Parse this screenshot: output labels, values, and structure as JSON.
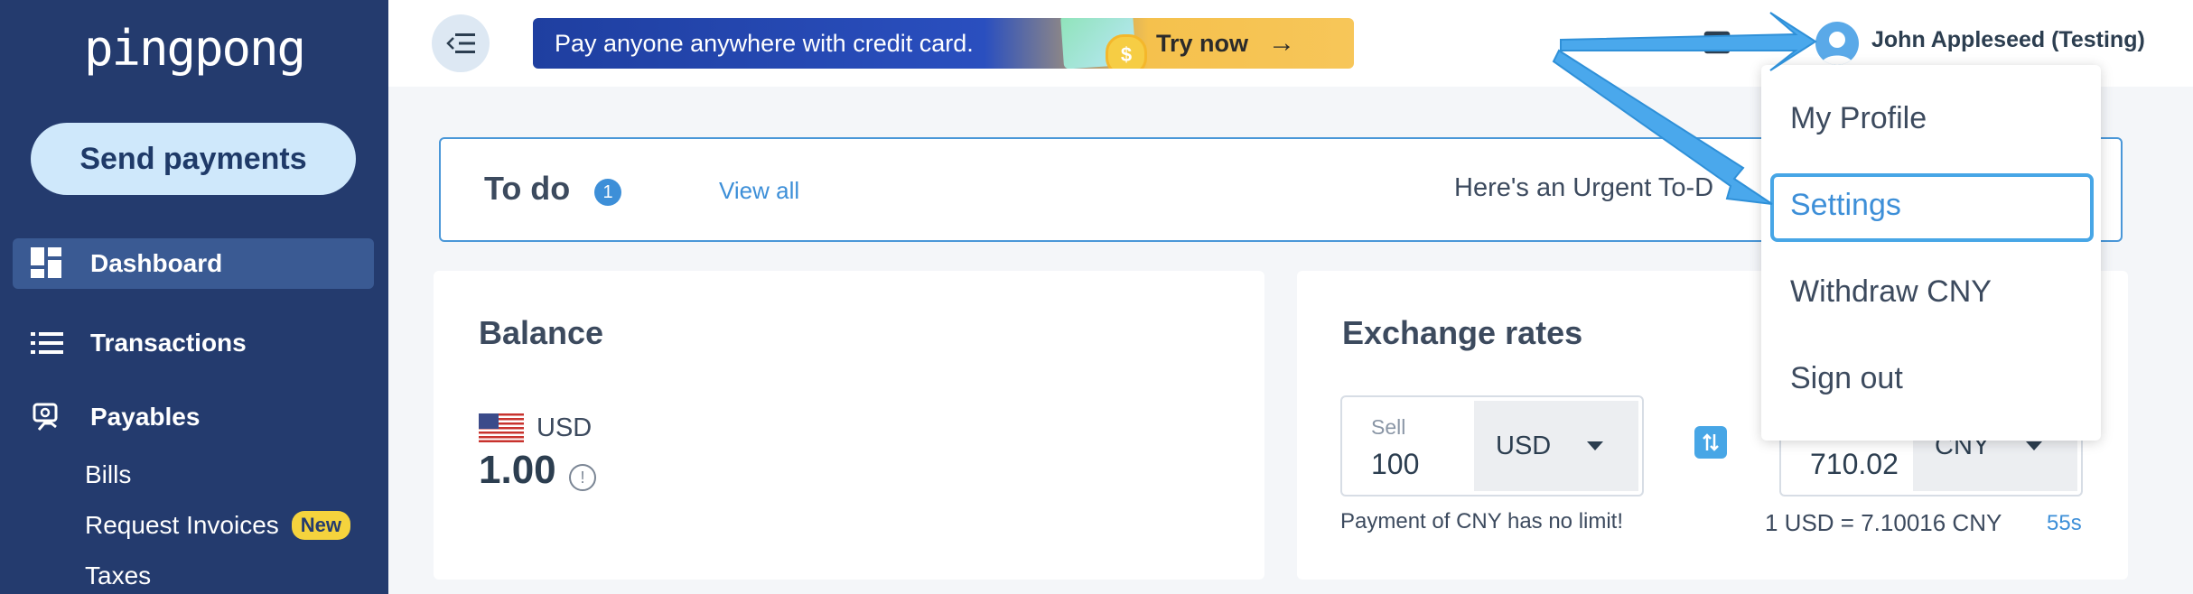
{
  "app": {
    "logo": "pingpong"
  },
  "sidebar": {
    "send_button": "Send payments",
    "items": [
      {
        "label": "Dashboard",
        "icon": "dashboard-icon",
        "active": true
      },
      {
        "label": "Transactions",
        "icon": "list-icon"
      },
      {
        "label": "Payables",
        "icon": "payables-icon"
      }
    ],
    "sub_items": [
      {
        "label": "Bills"
      },
      {
        "label": "Request Invoices",
        "badge": "New"
      },
      {
        "label": "Taxes"
      }
    ]
  },
  "topbar": {
    "promo_text": "Pay anyone anywhere with credit card.",
    "promo_cta": "Try now",
    "promo_coin": "$",
    "user_name": "John Appleseed (Testing)"
  },
  "todo": {
    "title": "To do",
    "count": "1",
    "view_all": "View all",
    "urgent_text": "Here's an Urgent To-D"
  },
  "balance": {
    "title": "Balance",
    "currency": "USD",
    "amount": "1.00",
    "info": "!"
  },
  "exchange": {
    "title": "Exchange rates",
    "sell_label": "Sell",
    "sell_value": "100",
    "sell_currency": "USD",
    "buy_value": "710.02",
    "buy_currency": "CNY",
    "note": "Payment of CNY has no limit!",
    "rate_text": "1 USD = 7.10016 CNY",
    "refresh_timer": "55s"
  },
  "user_menu": {
    "items": [
      "My Profile",
      "Settings",
      "Withdraw CNY",
      "Sign out"
    ],
    "selected": "Settings"
  },
  "colors": {
    "sidebar": "#243b6e",
    "accent": "#3d8fd8",
    "annotation_arrow": "#4aa8ec"
  }
}
